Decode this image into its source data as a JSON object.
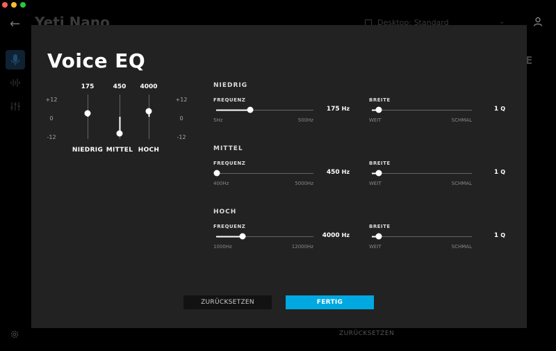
{
  "window": {
    "colors": {
      "close": "#ff5f57",
      "minimize": "#febc2e",
      "zoom": "#28c840"
    }
  },
  "background_app": {
    "back_arrow": "←",
    "device_title": "Yeti Nano",
    "preset_label": "Desktop: Standard",
    "chevron": "⌄",
    "partial_letter": "E",
    "reset_label": "ZURÜCKSETZEN",
    "icons": [
      "back-arrow-icon",
      "preset-icon",
      "user-icon",
      "microphone-icon",
      "waveform-icon",
      "equalizer-icon",
      "gear-icon"
    ]
  },
  "modal": {
    "title": "Voice EQ",
    "mini_eq": {
      "scale": {
        "top": "+12",
        "mid": "0",
        "bottom": "-12"
      },
      "bands": [
        {
          "id": "low",
          "freq": "175",
          "label": "NIEDRIG",
          "gain_db": 2
        },
        {
          "id": "mid",
          "freq": "450",
          "label": "MITTEL",
          "gain_db": -9
        },
        {
          "id": "high",
          "freq": "4000",
          "label": "HOCH",
          "gain_db": 3
        }
      ]
    },
    "bands": [
      {
        "title": "NIEDRIG",
        "freq_label": "FREQUENZ",
        "freq_value": "175",
        "freq_unit": "Hz",
        "freq_min": "5Hz",
        "freq_max": "500Hz",
        "freq_fraction": 0.35,
        "width_label": "BREITE",
        "width_value": "1",
        "width_unit": "Q",
        "width_min": "WEIT",
        "width_max": "SCHMAL",
        "width_fraction": 0.07
      },
      {
        "title": "MITTEL",
        "freq_label": "FREQUENZ",
        "freq_value": "450",
        "freq_unit": "Hz",
        "freq_min": "400Hz",
        "freq_max": "5000Hz",
        "freq_fraction": 0.01,
        "width_label": "BREITE",
        "width_value": "1",
        "width_unit": "Q",
        "width_min": "WEIT",
        "width_max": "SCHMAL",
        "width_fraction": 0.07
      },
      {
        "title": "HOCH",
        "freq_label": "FREQUENZ",
        "freq_value": "4000",
        "freq_unit": "Hz",
        "freq_min": "1000Hz",
        "freq_max": "12000Hz",
        "freq_fraction": 0.27,
        "width_label": "BREITE",
        "width_value": "1",
        "width_unit": "Q",
        "width_min": "WEIT",
        "width_max": "SCHMAL",
        "width_fraction": 0.07
      }
    ],
    "buttons": {
      "reset": "ZURÜCKSETZEN",
      "done": "FERTIG"
    },
    "accent": "#00a8e1"
  }
}
